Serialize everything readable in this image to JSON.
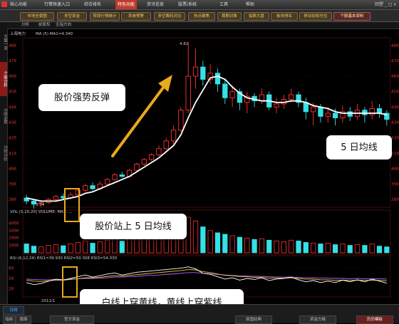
{
  "menubar": {
    "items": [
      "核心功能",
      "行情快速入口",
      "综合排名",
      "特色功能",
      "资讯信息",
      "股票/系统",
      "工具",
      "帮助"
    ],
    "active_index": 3,
    "right_text": "回塑 _ □ x"
  },
  "toolbar": {
    "buttons": [
      "市场全景图",
      "多空资金",
      "阶段行情统计",
      "系统预警",
      "多空筹码对比",
      "热点聚焦",
      "周期对象",
      "指数大盘",
      "板块排名",
      "移动加权仓位",
      "个股基本资料"
    ],
    "red_index": 10
  },
  "subbar": {
    "items": [
      "分析",
      "前复权",
      "主指方向"
    ]
  },
  "leftbar": {
    "items": [
      "大盘一览",
      "个股分析",
      "分时走势",
      "分时分价"
    ],
    "active_index": 1
  },
  "chart_info": {
    "title": "上海电力",
    "ma_text": "MA (5)    MA1=4.340",
    "vol_text": "VOL (5,10,20)  VOLUME:  MA1:  ...",
    "rsi_text": "RSI (6,12,24)  RSI1=39.930  RSI2=50.308  RSI3=54.030",
    "peak_label": "4.82",
    "low_label": "3.74",
    "date_label": "2011/1",
    "k_label": "日线"
  },
  "price_axis": {
    "ticks": [
      "480",
      "470",
      "460",
      "450",
      "440",
      "430",
      "420",
      "410",
      "400",
      "390",
      "380"
    ]
  },
  "vol_axis": {
    "ticks": [
      "4000",
      "3000",
      "2000",
      "1000"
    ]
  },
  "rsi_axis": {
    "ticks": [
      "80",
      "50",
      "20"
    ]
  },
  "bottombar": {
    "tabs": [
      "指标",
      "版面",
      "官方资金",
      "县国经典",
      "资金方格",
      "历历模板"
    ],
    "red_index": 5
  },
  "callouts": {
    "rebound": "股价强势反弹",
    "ma5": "5 日均线",
    "above_ma5": "股价站上 5 日均线",
    "cross": "白线上穿黄线，黄线上穿紫线"
  },
  "colors": {
    "up": "#ff3030",
    "down": "#35e0e6",
    "ma5": "#ffffff",
    "accent": "#e9a91c",
    "rsi1": "#ffffff",
    "rsi2": "#e0d040",
    "rsi3": "#c060ff"
  },
  "chart_data": {
    "type": "candlestick",
    "price_range": [
      375,
      485
    ],
    "candles": [
      {
        "o": 381,
        "c": 379,
        "h": 383,
        "l": 377
      },
      {
        "o": 379,
        "c": 377,
        "h": 380,
        "l": 374
      },
      {
        "o": 377,
        "c": 378,
        "h": 379,
        "l": 375
      },
      {
        "o": 378,
        "c": 380,
        "h": 381,
        "l": 377
      },
      {
        "o": 380,
        "c": 382,
        "h": 383,
        "l": 379
      },
      {
        "o": 382,
        "c": 381,
        "h": 384,
        "l": 380
      },
      {
        "o": 381,
        "c": 383,
        "h": 385,
        "l": 380
      },
      {
        "o": 383,
        "c": 386,
        "h": 387,
        "l": 382
      },
      {
        "o": 386,
        "c": 389,
        "h": 390,
        "l": 385
      },
      {
        "o": 389,
        "c": 387,
        "h": 391,
        "l": 386
      },
      {
        "o": 387,
        "c": 390,
        "h": 392,
        "l": 386
      },
      {
        "o": 390,
        "c": 393,
        "h": 394,
        "l": 389
      },
      {
        "o": 393,
        "c": 396,
        "h": 397,
        "l": 392
      },
      {
        "o": 396,
        "c": 395,
        "h": 398,
        "l": 394
      },
      {
        "o": 395,
        "c": 399,
        "h": 400,
        "l": 394
      },
      {
        "o": 399,
        "c": 403,
        "h": 404,
        "l": 398
      },
      {
        "o": 403,
        "c": 406,
        "h": 407,
        "l": 402
      },
      {
        "o": 406,
        "c": 409,
        "h": 410,
        "l": 405
      },
      {
        "o": 409,
        "c": 413,
        "h": 415,
        "l": 408
      },
      {
        "o": 413,
        "c": 418,
        "h": 420,
        "l": 412
      },
      {
        "o": 418,
        "c": 425,
        "h": 428,
        "l": 416
      },
      {
        "o": 425,
        "c": 438,
        "h": 440,
        "l": 424
      },
      {
        "o": 438,
        "c": 460,
        "h": 482,
        "l": 436
      },
      {
        "o": 460,
        "c": 466,
        "h": 478,
        "l": 452
      },
      {
        "o": 466,
        "c": 458,
        "h": 470,
        "l": 454
      },
      {
        "o": 458,
        "c": 462,
        "h": 468,
        "l": 455
      },
      {
        "o": 462,
        "c": 455,
        "h": 465,
        "l": 450
      },
      {
        "o": 455,
        "c": 446,
        "h": 458,
        "l": 442
      },
      {
        "o": 446,
        "c": 450,
        "h": 454,
        "l": 440
      },
      {
        "o": 450,
        "c": 443,
        "h": 452,
        "l": 438
      },
      {
        "o": 443,
        "c": 447,
        "h": 450,
        "l": 436
      },
      {
        "o": 447,
        "c": 444,
        "h": 449,
        "l": 440
      },
      {
        "o": 444,
        "c": 448,
        "h": 452,
        "l": 442
      },
      {
        "o": 448,
        "c": 440,
        "h": 450,
        "l": 438
      },
      {
        "o": 440,
        "c": 442,
        "h": 446,
        "l": 436
      },
      {
        "o": 442,
        "c": 445,
        "h": 448,
        "l": 439
      },
      {
        "o": 445,
        "c": 448,
        "h": 452,
        "l": 443
      },
      {
        "o": 448,
        "c": 443,
        "h": 450,
        "l": 440
      },
      {
        "o": 443,
        "c": 437,
        "h": 446,
        "l": 432
      },
      {
        "o": 437,
        "c": 440,
        "h": 443,
        "l": 428
      },
      {
        "o": 440,
        "c": 434,
        "h": 442,
        "l": 430
      },
      {
        "o": 434,
        "c": 436,
        "h": 440,
        "l": 430
      },
      {
        "o": 436,
        "c": 433,
        "h": 439,
        "l": 428
      },
      {
        "o": 433,
        "c": 437,
        "h": 441,
        "l": 430
      },
      {
        "o": 437,
        "c": 434,
        "h": 440,
        "l": 431
      },
      {
        "o": 434,
        "c": 438,
        "h": 442,
        "l": 432
      },
      {
        "o": 438,
        "c": 435,
        "h": 440,
        "l": 430
      },
      {
        "o": 435,
        "c": 439,
        "h": 444,
        "l": 432
      },
      {
        "o": 439,
        "c": 436,
        "h": 442,
        "l": 433
      },
      {
        "o": 436,
        "c": 432,
        "h": 438,
        "l": 428
      }
    ],
    "ma5": [
      381,
      380,
      379,
      379,
      379,
      380,
      381,
      382,
      384,
      385,
      387,
      389,
      391,
      393,
      395,
      398,
      401,
      404,
      407,
      411,
      415,
      422,
      433,
      443,
      451,
      459,
      460,
      458,
      453,
      449,
      446,
      445,
      444,
      444,
      443,
      443,
      444,
      444,
      443,
      441,
      440,
      439,
      437,
      436,
      436,
      436,
      436,
      436,
      436,
      435
    ],
    "volume": [
      1200,
      900,
      800,
      1000,
      1100,
      950,
      1200,
      1400,
      1600,
      1300,
      1500,
      1700,
      1900,
      1600,
      2000,
      2200,
      2400,
      2600,
      2800,
      3200,
      3600,
      4200,
      4800,
      4300,
      3500,
      3000,
      2700,
      2500,
      2300,
      2100,
      2000,
      1800,
      1900,
      1700,
      1600,
      1500,
      1700,
      1600,
      1400,
      1300,
      1200,
      1300,
      1100,
      1200,
      1000,
      1100,
      1000,
      1200,
      900,
      800
    ],
    "rsi1": [
      38,
      32,
      35,
      42,
      48,
      45,
      50,
      55,
      60,
      54,
      58,
      63,
      66,
      60,
      64,
      68,
      70,
      72,
      74,
      76,
      78,
      80,
      84,
      78,
      65,
      62,
      55,
      48,
      52,
      45,
      50,
      47,
      52,
      44,
      48,
      50,
      54,
      46,
      40,
      44,
      38,
      42,
      38,
      45,
      40,
      46,
      40,
      48,
      42,
      36
    ],
    "rsi2": [
      45,
      42,
      41,
      43,
      45,
      45,
      47,
      49,
      52,
      52,
      53,
      56,
      58,
      57,
      59,
      61,
      63,
      65,
      67,
      69,
      71,
      73,
      76,
      75,
      70,
      67,
      63,
      59,
      58,
      55,
      55,
      53,
      53,
      51,
      51,
      51,
      52,
      50,
      48,
      48,
      46,
      46,
      44,
      45,
      44,
      45,
      44,
      45,
      44,
      43
    ],
    "rsi3": [
      48,
      47,
      46,
      46,
      47,
      47,
      48,
      49,
      50,
      50,
      51,
      52,
      54,
      54,
      55,
      56,
      58,
      59,
      60,
      62,
      63,
      65,
      67,
      67,
      65,
      64,
      62,
      60,
      59,
      58,
      57,
      56,
      56,
      55,
      54,
      54,
      54,
      53,
      52,
      52,
      51,
      51,
      50,
      50,
      49,
      50,
      49,
      49,
      49,
      48
    ]
  }
}
